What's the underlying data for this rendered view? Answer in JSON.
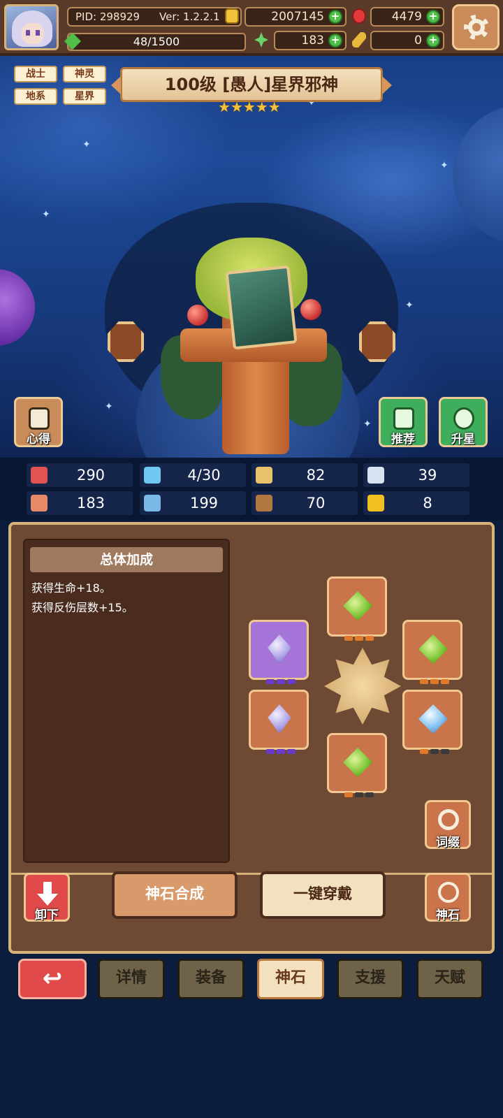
{
  "header": {
    "pid": "PID: 298929",
    "version": "Ver: 1.2.2.1",
    "gold": "2007145",
    "gems": "4479",
    "energy": "48/1500",
    "energy_fraction": 0.032,
    "clover": "183",
    "key_item": "0",
    "icons": {
      "gold": "gold-coin-icon",
      "gem": "red-gem-icon",
      "energy": "green-leaf-icon",
      "clover": "clover-icon",
      "key": "key-icon",
      "settings": "gear-icon"
    }
  },
  "hero": {
    "tags": [
      "战士",
      "神灵",
      "地系",
      "星界"
    ],
    "title": "100级 [愚人]星界邪神",
    "stars": 5
  },
  "scene_buttons": {
    "notes": "心得",
    "recommend": "推荐",
    "star_up": "升星"
  },
  "stats": [
    {
      "icon": "heart-icon",
      "value": "290",
      "color": "#e25454"
    },
    {
      "icon": "water-drop-icon",
      "value": "4/30",
      "color": "#6ec8f0"
    },
    {
      "icon": "shield-icon",
      "value": "82",
      "color": "#e8c26a"
    },
    {
      "icon": "wing-icon",
      "value": "39",
      "color": "#d8e2f0"
    },
    {
      "icon": "fist-icon",
      "value": "183",
      "color": "#e88a6a"
    },
    {
      "icon": "book-icon",
      "value": "199",
      "color": "#7ab8e8"
    },
    {
      "icon": "boot-icon",
      "value": "70",
      "color": "#b07840"
    },
    {
      "icon": "horseshoe-icon",
      "value": "8",
      "color": "#f0c020"
    }
  ],
  "bonus": {
    "title": "总体加成",
    "lines": [
      "获得生命+18。",
      "获得反伤层数+15。"
    ]
  },
  "actions": {
    "affix": "词缀",
    "unequip": "卸下",
    "synthesize": "神石合成",
    "equip_all": "一键穿戴",
    "godstone": "神石"
  },
  "tabs": [
    "详情",
    "装备",
    "神石",
    "支援",
    "天赋"
  ],
  "active_tab": "神石",
  "colors": {
    "accent": "#d9b27a",
    "panel": "#6e4a34",
    "active_tab": "#f3e0bf"
  }
}
